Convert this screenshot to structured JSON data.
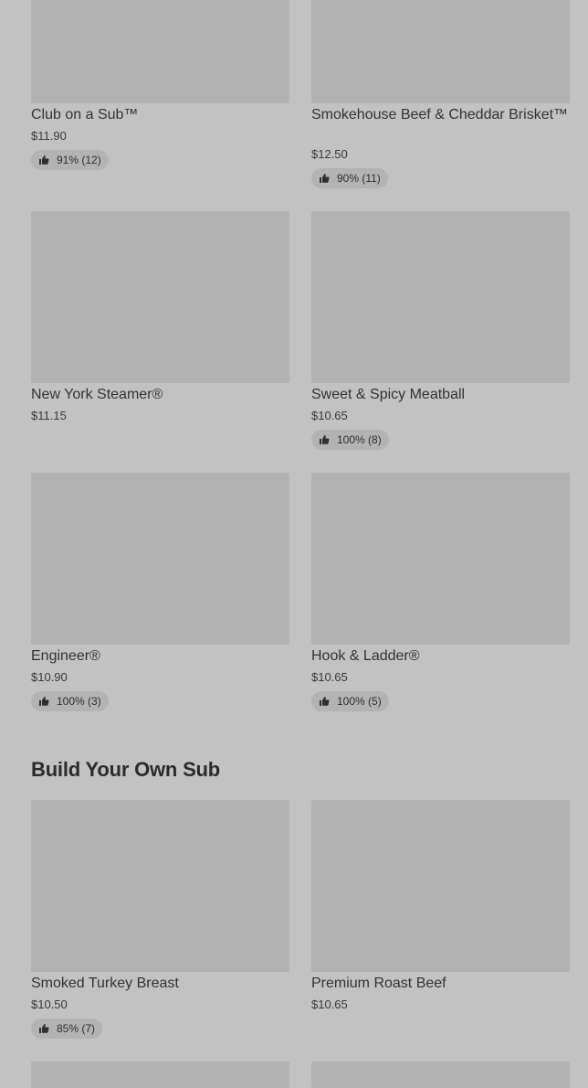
{
  "colors": {
    "background": "#c2c2c2",
    "image_placeholder": "#b2b2b2",
    "badge_background": "#b3b3b3",
    "text": "#333333"
  },
  "items": [
    {
      "name": "Club on a Sub™",
      "price": "$11.90",
      "rating": "91% (12)",
      "icon": "thumbs-up-icon"
    },
    {
      "name": "Smokehouse Beef & Cheddar Brisket™",
      "price": "$12.50",
      "rating": "90% (11)",
      "icon": "thumbs-up-icon"
    },
    {
      "name": "New York Steamer®",
      "price": "$11.15",
      "rating": null
    },
    {
      "name": "Sweet & Spicy Meatball",
      "price": "$10.65",
      "rating": "100% (8)",
      "icon": "thumbs-up-icon"
    },
    {
      "name": "Engineer®",
      "price": "$10.90",
      "rating": "100% (3)",
      "icon": "thumbs-up-icon"
    },
    {
      "name": "Hook & Ladder®",
      "price": "$10.65",
      "rating": "100% (5)",
      "icon": "thumbs-up-icon"
    }
  ],
  "section": {
    "title": "Build Your Own Sub"
  },
  "section_items": [
    {
      "name": "Smoked Turkey Breast",
      "price": "$10.50",
      "rating": "85% (7)",
      "icon": "thumbs-up-icon"
    },
    {
      "name": "Premium Roast Beef",
      "price": "$10.65",
      "rating": null
    }
  ]
}
